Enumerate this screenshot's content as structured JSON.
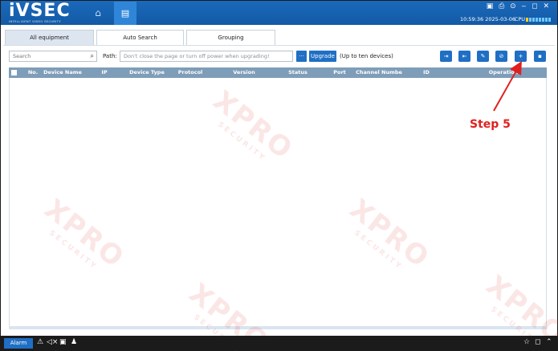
{
  "app": {
    "logo_text": "iVSEC",
    "logo_subtitle": "INTELLIGENT VIDEO SECURITY",
    "home_icon": "home-icon",
    "device_icon": "device-list-icon",
    "window_icons": "▣ ⎙ ⊙ ‒ ◻ ✕",
    "datetime": "10:59:36 2025-03-06",
    "cpu_label": "CPU"
  },
  "tabs": [
    {
      "label": "All equipment",
      "active": true
    },
    {
      "label": "Auto Search",
      "active": false
    },
    {
      "label": "Grouping",
      "active": false
    }
  ],
  "toolbar": {
    "search_placeholder": "Search",
    "path_label": "Path:",
    "path_placeholder": "Don't close the page or turn off power when upgrading!",
    "browse_label": "...",
    "upgrade_label": "Upgrade",
    "upgrade_note": "(Up to ten devices)",
    "actions": [
      "import",
      "export",
      "edit",
      "delete",
      "add",
      "clear"
    ]
  },
  "table": {
    "columns": [
      "No.",
      "Device Name",
      "IP",
      "Device Type",
      "Protocol",
      "Version",
      "Status",
      "Port",
      "Channel Numbe",
      "ID",
      "Operation"
    ],
    "rows": []
  },
  "watermark": {
    "big": "XPRO",
    "small": "SECURITY"
  },
  "annotation": {
    "step_label": "Step 5"
  },
  "statusbar": {
    "alarm_label": "Alarm"
  },
  "colors": {
    "titlebar": "#1a69bb",
    "accent": "#1f6fc4",
    "table_header": "#7e9db8",
    "annotation": "#e02020"
  }
}
